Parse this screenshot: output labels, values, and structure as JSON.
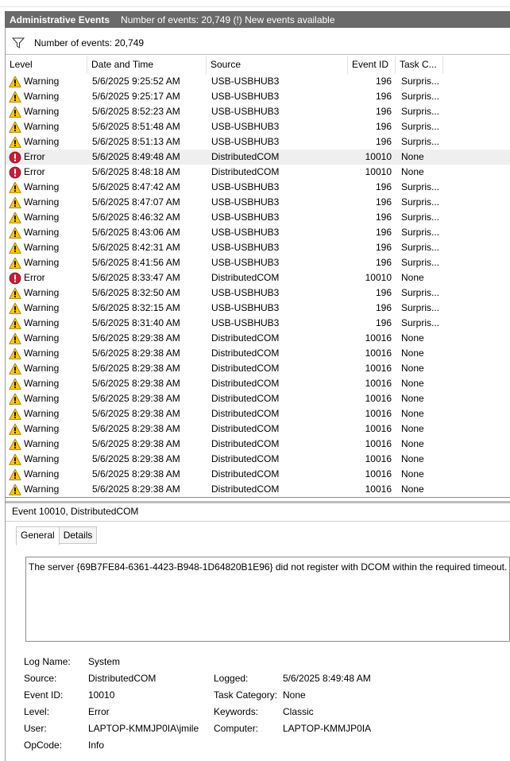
{
  "header": {
    "title": "Administrative Events",
    "subtitle": "Number of events: 20,749 (!) New events available"
  },
  "filter": {
    "icon": "filter-icon",
    "label": "Number of events: 20,749"
  },
  "table": {
    "columns": [
      "Level",
      "Date and Time",
      "Source",
      "Event ID",
      "Task C..."
    ],
    "selected_index": 5,
    "rows": [
      {
        "level": "Warning",
        "date": "5/6/2025 9:25:52 AM",
        "source": "USB-USBHUB3",
        "event_id": "196",
        "task": "Surpris..."
      },
      {
        "level": "Warning",
        "date": "5/6/2025 9:25:17 AM",
        "source": "USB-USBHUB3",
        "event_id": "196",
        "task": "Surpris..."
      },
      {
        "level": "Warning",
        "date": "5/6/2025 8:52:23 AM",
        "source": "USB-USBHUB3",
        "event_id": "196",
        "task": "Surpris..."
      },
      {
        "level": "Warning",
        "date": "5/6/2025 8:51:48 AM",
        "source": "USB-USBHUB3",
        "event_id": "196",
        "task": "Surpris..."
      },
      {
        "level": "Warning",
        "date": "5/6/2025 8:51:13 AM",
        "source": "USB-USBHUB3",
        "event_id": "196",
        "task": "Surpris..."
      },
      {
        "level": "Error",
        "date": "5/6/2025 8:49:48 AM",
        "source": "DistributedCOM",
        "event_id": "10010",
        "task": "None"
      },
      {
        "level": "Error",
        "date": "5/6/2025 8:48:18 AM",
        "source": "DistributedCOM",
        "event_id": "10010",
        "task": "None"
      },
      {
        "level": "Warning",
        "date": "5/6/2025 8:47:42 AM",
        "source": "USB-USBHUB3",
        "event_id": "196",
        "task": "Surpris..."
      },
      {
        "level": "Warning",
        "date": "5/6/2025 8:47:07 AM",
        "source": "USB-USBHUB3",
        "event_id": "196",
        "task": "Surpris..."
      },
      {
        "level": "Warning",
        "date": "5/6/2025 8:46:32 AM",
        "source": "USB-USBHUB3",
        "event_id": "196",
        "task": "Surpris..."
      },
      {
        "level": "Warning",
        "date": "5/6/2025 8:43:06 AM",
        "source": "USB-USBHUB3",
        "event_id": "196",
        "task": "Surpris..."
      },
      {
        "level": "Warning",
        "date": "5/6/2025 8:42:31 AM",
        "source": "USB-USBHUB3",
        "event_id": "196",
        "task": "Surpris..."
      },
      {
        "level": "Warning",
        "date": "5/6/2025 8:41:56 AM",
        "source": "USB-USBHUB3",
        "event_id": "196",
        "task": "Surpris..."
      },
      {
        "level": "Error",
        "date": "5/6/2025 8:33:47 AM",
        "source": "DistributedCOM",
        "event_id": "10010",
        "task": "None"
      },
      {
        "level": "Warning",
        "date": "5/6/2025 8:32:50 AM",
        "source": "USB-USBHUB3",
        "event_id": "196",
        "task": "Surpris..."
      },
      {
        "level": "Warning",
        "date": "5/6/2025 8:32:15 AM",
        "source": "USB-USBHUB3",
        "event_id": "196",
        "task": "Surpris..."
      },
      {
        "level": "Warning",
        "date": "5/6/2025 8:31:40 AM",
        "source": "USB-USBHUB3",
        "event_id": "196",
        "task": "Surpris..."
      },
      {
        "level": "Warning",
        "date": "5/6/2025 8:29:38 AM",
        "source": "DistributedCOM",
        "event_id": "10016",
        "task": "None"
      },
      {
        "level": "Warning",
        "date": "5/6/2025 8:29:38 AM",
        "source": "DistributedCOM",
        "event_id": "10016",
        "task": "None"
      },
      {
        "level": "Warning",
        "date": "5/6/2025 8:29:38 AM",
        "source": "DistributedCOM",
        "event_id": "10016",
        "task": "None"
      },
      {
        "level": "Warning",
        "date": "5/6/2025 8:29:38 AM",
        "source": "DistributedCOM",
        "event_id": "10016",
        "task": "None"
      },
      {
        "level": "Warning",
        "date": "5/6/2025 8:29:38 AM",
        "source": "DistributedCOM",
        "event_id": "10016",
        "task": "None"
      },
      {
        "level": "Warning",
        "date": "5/6/2025 8:29:38 AM",
        "source": "DistributedCOM",
        "event_id": "10016",
        "task": "None"
      },
      {
        "level": "Warning",
        "date": "5/6/2025 8:29:38 AM",
        "source": "DistributedCOM",
        "event_id": "10016",
        "task": "None"
      },
      {
        "level": "Warning",
        "date": "5/6/2025 8:29:38 AM",
        "source": "DistributedCOM",
        "event_id": "10016",
        "task": "None"
      },
      {
        "level": "Warning",
        "date": "5/6/2025 8:29:38 AM",
        "source": "DistributedCOM",
        "event_id": "10016",
        "task": "None"
      },
      {
        "level": "Warning",
        "date": "5/6/2025 8:29:38 AM",
        "source": "DistributedCOM",
        "event_id": "10016",
        "task": "None"
      },
      {
        "level": "Warning",
        "date": "5/6/2025 8:29:38 AM",
        "source": "DistributedCOM",
        "event_id": "10016",
        "task": "None"
      }
    ]
  },
  "detail": {
    "title": "Event 10010, DistributedCOM",
    "tabs": [
      "General",
      "Details"
    ],
    "active_tab": "General",
    "message": "The server {69B7FE84-6361-4423-B948-1D64820B1E96} did not register with DCOM within the required timeout.",
    "props": {
      "log_name_label": "Log Name:",
      "log_name": "System",
      "source_label": "Source:",
      "source": "DistributedCOM",
      "logged_label": "Logged:",
      "logged": "5/6/2025 8:49:48 AM",
      "event_id_label": "Event ID:",
      "event_id": "10010",
      "task_category_label": "Task Category:",
      "task_category": "None",
      "level_label": "Level:",
      "level": "Error",
      "keywords_label": "Keywords:",
      "keywords": "Classic",
      "user_label": "User:",
      "user": "LAPTOP-KMMJP0IA\\jmile",
      "computer_label": "Computer:",
      "computer": "LAPTOP-KMMJP0IA",
      "opcode_label": "OpCode:",
      "opcode": "Info"
    }
  },
  "colors": {
    "header_bg": "#6a6a6a",
    "warning": "#f7c51b",
    "error": "#c0213a",
    "selected_row": "#efefef"
  },
  "icons": {
    "warning": "warning-icon",
    "error": "error-icon"
  }
}
